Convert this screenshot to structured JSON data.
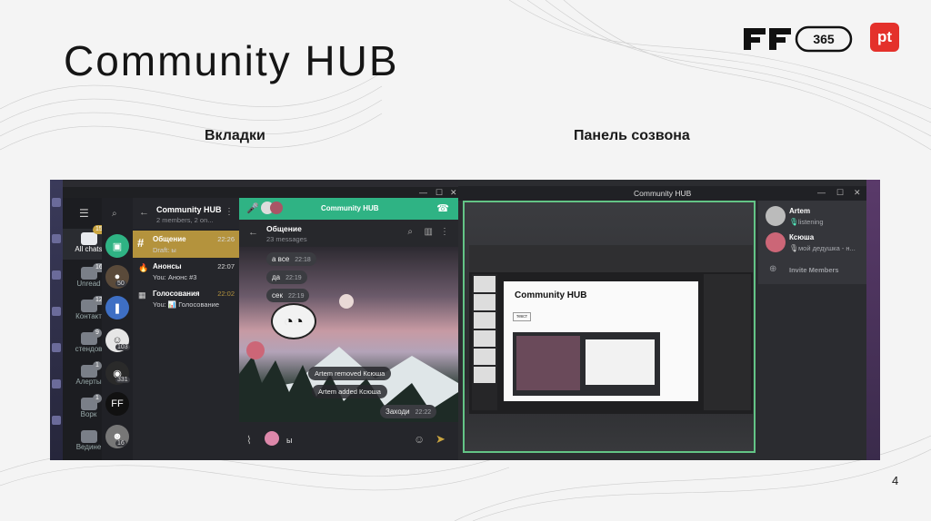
{
  "slide": {
    "title": "Community HUB",
    "caption_tabs": "Вкладки",
    "caption_call": "Панель созвона",
    "page_number": "4",
    "logo_ff_text": "365",
    "logo_pt_text": "pt"
  },
  "tg": {
    "folders": [
      {
        "label": "All chats",
        "badge": "154"
      },
      {
        "label": "Unread",
        "badge": "168"
      },
      {
        "label": "Контакт",
        "badge": "12"
      },
      {
        "label": "стендов",
        "badge": "9"
      },
      {
        "label": "Алерты",
        "badge": "1"
      },
      {
        "label": "Ворк",
        "badge": "1"
      },
      {
        "label": "Ведине",
        "badge": ""
      }
    ],
    "avatar_counts": [
      "50",
      "103",
      "331",
      "16"
    ],
    "header": {
      "title": "Community HUB",
      "subtitle": "2 members, 2 on..."
    },
    "rows": [
      {
        "name": "Общение",
        "preview": "Draft: ы",
        "time": "22:26",
        "mark": "#"
      },
      {
        "name": "Анонсы",
        "preview": "You: Анонс #3",
        "time": "22:07",
        "mark": "🔥"
      },
      {
        "name": "Голосования",
        "preview": "You: 📊 Голосование",
        "time": "22:02",
        "mark": "▦"
      }
    ],
    "call_title": "Community HUB",
    "chat_title": "Общение",
    "chat_sub": "23 messages",
    "messages": [
      {
        "text": "а все",
        "time": "22:18"
      },
      {
        "text": "да",
        "time": "22:19"
      },
      {
        "text": "сек",
        "time": "22:19"
      }
    ],
    "system": [
      "Artem removed Ксюша",
      "Artem added Ксюша"
    ],
    "last": {
      "text": "Заходи",
      "time": "22:22"
    },
    "composer_text": "ы"
  },
  "call": {
    "window_title": "Community HUB",
    "slide_title": "Community HUB",
    "slide_text": "текст",
    "participants": [
      {
        "name": "Artem",
        "status": "listening"
      },
      {
        "name": "Ксюша",
        "status": "мой дедушка - н..."
      }
    ],
    "invite": "Invite Members"
  },
  "colors": {
    "accent_gold": "#b4933d",
    "call_green": "#2fb384",
    "speaker_border": "#63c486",
    "pt_red": "#e4312b"
  }
}
